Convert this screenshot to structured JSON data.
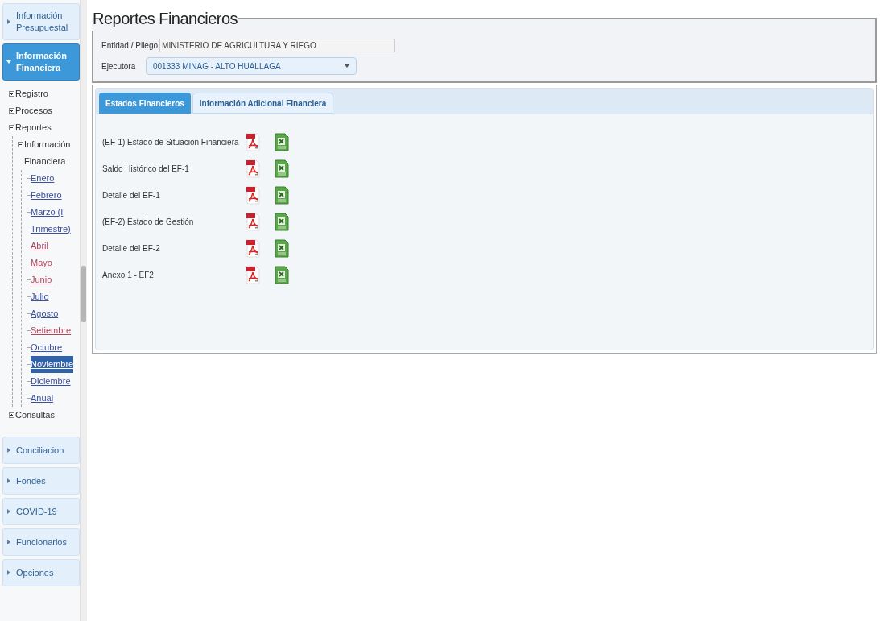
{
  "sidebar": {
    "sections": [
      {
        "label": "Información Presupuestal",
        "expanded": false
      },
      {
        "label": "Información Financiera",
        "expanded": true,
        "tree": [
          {
            "label": "Registro",
            "kind": "folder",
            "expanded": false
          },
          {
            "label": "Procesos",
            "kind": "folder",
            "expanded": false
          },
          {
            "label": "Reportes",
            "kind": "folder",
            "expanded": true,
            "children": [
              {
                "label": "Información Financiera",
                "kind": "folder",
                "expanded": true,
                "children": [
                  {
                    "label": "Enero",
                    "kind": "link",
                    "visited": false,
                    "selected": false
                  },
                  {
                    "label": "Febrero",
                    "kind": "link",
                    "visited": false,
                    "selected": false
                  },
                  {
                    "label": "Marzo (I Trimestre)",
                    "kind": "link",
                    "visited": false,
                    "selected": false
                  },
                  {
                    "label": "Abril",
                    "kind": "link",
                    "visited": true,
                    "selected": false
                  },
                  {
                    "label": "Mayo",
                    "kind": "link",
                    "visited": true,
                    "selected": false
                  },
                  {
                    "label": "Junio",
                    "kind": "link",
                    "visited": true,
                    "selected": false
                  },
                  {
                    "label": "Julio",
                    "kind": "link",
                    "visited": false,
                    "selected": false
                  },
                  {
                    "label": "Agosto",
                    "kind": "link",
                    "visited": false,
                    "selected": false
                  },
                  {
                    "label": "Setiembre",
                    "kind": "link",
                    "visited": true,
                    "selected": false
                  },
                  {
                    "label": "Octubre",
                    "kind": "link",
                    "visited": false,
                    "selected": false
                  },
                  {
                    "label": "Noviembre",
                    "kind": "link",
                    "visited": false,
                    "selected": true
                  },
                  {
                    "label": "Diciembre",
                    "kind": "link",
                    "visited": false,
                    "selected": false
                  },
                  {
                    "label": "Anual",
                    "kind": "link",
                    "visited": false,
                    "selected": false
                  }
                ]
              }
            ]
          },
          {
            "label": "Consultas",
            "kind": "folder",
            "expanded": false
          }
        ]
      },
      {
        "label": "Conciliacion",
        "expanded": false
      },
      {
        "label": "Fondes",
        "expanded": false
      },
      {
        "label": "COVID-19",
        "expanded": false
      },
      {
        "label": "Funcionarios",
        "expanded": false
      },
      {
        "label": "Opciones",
        "expanded": false
      }
    ]
  },
  "title": "Reportes Financieros",
  "fields": [
    {
      "label": "Entidad / Pliego",
      "value": "MINISTERIO DE AGRICULTURA Y RIEGO",
      "kind": "text"
    },
    {
      "label": "Ejecutora",
      "value": "001333 MINAG - ALTO HUALLAGA",
      "kind": "select"
    }
  ],
  "tabs": [
    {
      "label": "Estados Financieros",
      "selected": true
    },
    {
      "label": "Información Adicional Financiera",
      "selected": false
    }
  ],
  "reports": [
    {
      "label": "(EF-1) Estado de Situación Financiera"
    },
    {
      "label": "Saldo Histórico del EF-1"
    },
    {
      "label": "Detalle del EF-1"
    },
    {
      "label": "(EF-2) Estado de Gestión"
    },
    {
      "label": "Detalle del EF-2"
    },
    {
      "label": "Anexo 1 - EF2"
    }
  ]
}
